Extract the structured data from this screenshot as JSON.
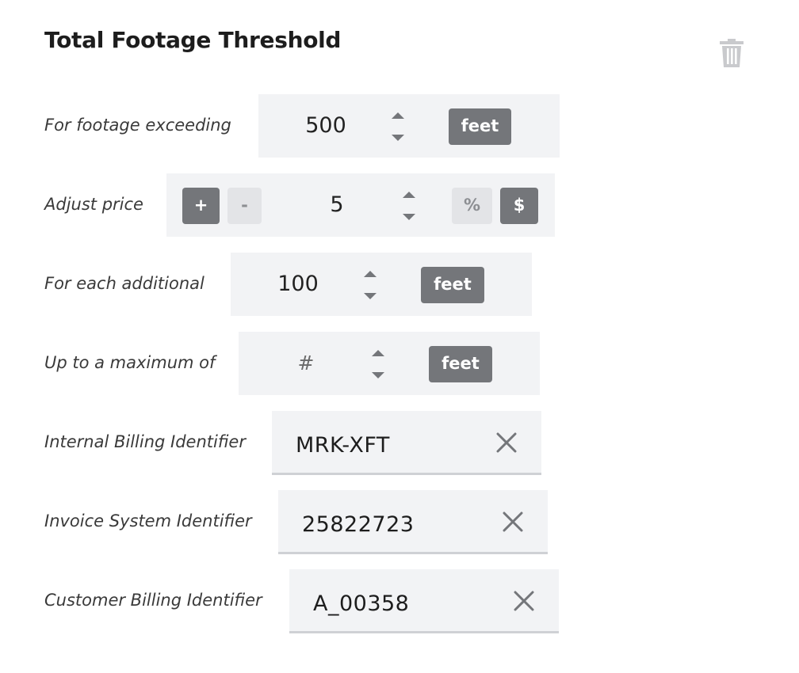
{
  "title": "Total Footage Threshold",
  "icons": {
    "delete": "trash-icon",
    "spinner": "up-down-arrows-icon",
    "clear": "close-icon"
  },
  "colors": {
    "active_button": "#74767a",
    "inactive_button": "#e3e4e7",
    "panel_background": "#f2f3f5",
    "delete_icon": "#c9cacd"
  },
  "footage_exceeding": {
    "label": "For footage exceeding",
    "value": "500",
    "unit": "feet"
  },
  "adjust_price": {
    "label": "Adjust price",
    "plus_label": "+",
    "minus_label": "-",
    "value": "5",
    "percent_label": "%",
    "dollar_label": "$",
    "selected_sign": "+",
    "selected_unit": "$"
  },
  "each_additional": {
    "label": "For each additional",
    "value": "100",
    "unit": "feet"
  },
  "maximum": {
    "label": "Up to a maximum of",
    "placeholder": "#",
    "unit": "feet"
  },
  "internal_billing": {
    "label": "Internal Billing Identifier",
    "value": "MRK-XFT"
  },
  "invoice_system": {
    "label": "Invoice System Identifier",
    "value": "25822723"
  },
  "customer_billing": {
    "label": "Customer Billing Identifier",
    "value": "A_00358"
  }
}
